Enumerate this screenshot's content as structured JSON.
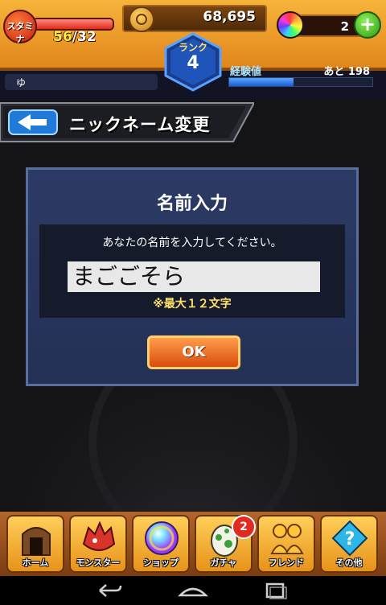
{
  "status": {
    "stamina_label": "スタミナ",
    "stamina_current": "56",
    "stamina_max": "/32",
    "stamina_fill_percent": 100,
    "gold": "68,695",
    "orb_count": "2",
    "rank_label": "ランク",
    "rank_value": "4",
    "player_name": "ゆ",
    "exp_label": "経験値",
    "exp_remaining": "あと 198",
    "exp_fill_percent": 45
  },
  "header": {
    "title": "ニックネーム変更"
  },
  "dialog": {
    "title": "名前入力",
    "prompt": "あなたの名前を入力してください。",
    "input_value": "まごごそら",
    "max_note": "※最大１２文字",
    "ok_label": "OK"
  },
  "nav": {
    "home": "ホーム",
    "monster": "モンスター",
    "shop": "ショップ",
    "gacha": "ガチャ",
    "gacha_badge": "2",
    "friend": "フレンド",
    "other": "その他"
  },
  "colors": {
    "accent_orange": "#e7921a",
    "dialog_bg": "#2c3a66",
    "ok_button": "#d94c0e"
  }
}
